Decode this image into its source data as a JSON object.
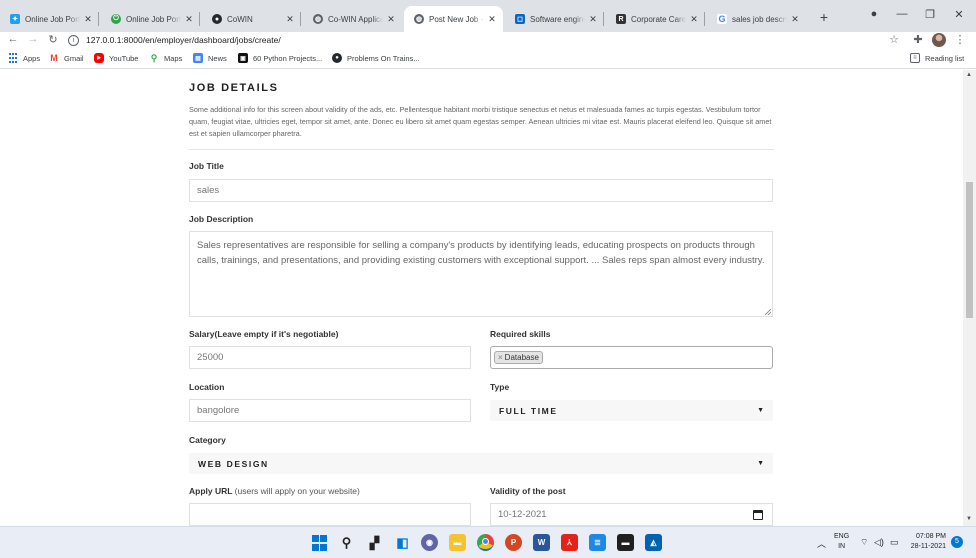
{
  "browser": {
    "tabs": [
      {
        "title": "Online Job Portal",
        "favicon": "twitter-bird-icon",
        "color": "#1da1f2",
        "active": false
      },
      {
        "title": "Online Job Portal",
        "favicon": "green-circle-icon",
        "color": "#2ea44f",
        "active": false
      },
      {
        "title": "CoWIN",
        "favicon": "github-icon",
        "color": "#24292e",
        "active": false
      },
      {
        "title": "Co-WIN Application",
        "favicon": "globe-icon",
        "color": "#5f6368",
        "active": false
      },
      {
        "title": "Post New Job - D",
        "favicon": "globe-icon",
        "color": "#5f6368",
        "active": true
      },
      {
        "title": "Software engineer",
        "favicon": "blue-square-icon",
        "color": "#0a66c2",
        "active": false
      },
      {
        "title": "Corporate Career",
        "favicon": "r-logo-icon",
        "color": "#333333",
        "active": false
      },
      {
        "title": "sales job descript",
        "favicon": "google-icon",
        "color": "#4285f4",
        "active": false
      }
    ],
    "url": "127.0.0.1:8000/en/employer/dashboard/jobs/create/",
    "bookmarks": [
      "Apps",
      "Gmail",
      "YouTube",
      "Maps",
      "News",
      "60 Python Projects...",
      "Problems On Trains..."
    ],
    "reading_list": "Reading list"
  },
  "form": {
    "section_title": "JOB DETAILS",
    "section_desc": "Some additional info for this screen about validity of the ads, etc. Pellentesque habitant morbi tristique senectus et netus et malesuada fames ac turpis egestas. Vestibulum tortor quam, feugiat vitae, ultricies eget, tempor sit amet, ante. Donec eu libero sit amet quam egestas semper. Aenean ultricies mi vitae est. Mauris placerat eleifend leo. Quisque sit amet est et sapien ullamcorper pharetra.",
    "job_title_label": "Job Title",
    "job_title_value": "sales",
    "job_desc_label": "Job Description",
    "job_desc_value": "Sales representatives are responsible for selling a company's products by identifying leads, educating prospects on products through calls, trainings, and presentations, and providing existing customers with exceptional support. ... Sales reps span almost every industry.",
    "salary_label": "Salary(Leave empty if it's negotiable)",
    "salary_value": "25000",
    "skills_label": "Required skills",
    "skills": [
      "Database"
    ],
    "location_label": "Location",
    "location_value": "bangolore",
    "type_label": "Type",
    "type_value": "FULL TIME",
    "category_label": "Category",
    "category_value": "WEB DESIGN",
    "apply_url_label_bold": "Apply URL",
    "apply_url_label_note": "(users will apply on your website)",
    "apply_url_value": "",
    "validity_label": "Validity of the post",
    "validity_value": "10-12-2021"
  },
  "taskbar": {
    "lang_top": "ENG",
    "lang_bottom": "IN",
    "time": "07:08 PM",
    "date": "28-11-2021",
    "notifications": "5"
  }
}
